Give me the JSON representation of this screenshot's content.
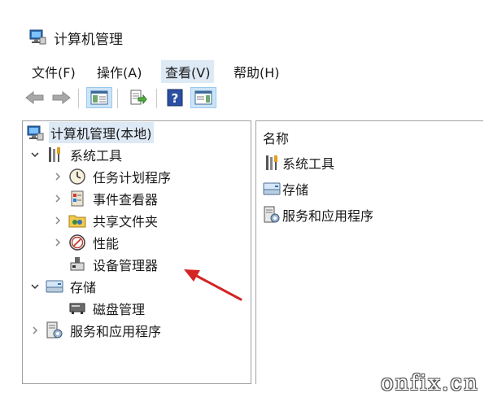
{
  "window": {
    "title": "计算机管理",
    "app_icon": "computer-management-icon"
  },
  "menu": [
    {
      "label": "文件(F)"
    },
    {
      "label": "操作(A)"
    },
    {
      "label": "查看(V)",
      "active": true
    },
    {
      "label": "帮助(H)"
    }
  ],
  "toolbar": [
    {
      "name": "back-button",
      "icon": "back-arrow-icon"
    },
    {
      "name": "forward-button",
      "icon": "forward-arrow-icon"
    },
    {
      "name": "show-hide-tree-button",
      "icon": "tree-panel-icon"
    },
    {
      "name": "export-list-button",
      "icon": "export-icon"
    },
    {
      "name": "help-button",
      "icon": "help-icon"
    },
    {
      "name": "show-action-pane-button",
      "icon": "action-pane-icon"
    }
  ],
  "tree": {
    "root": {
      "label": "计算机管理(本地)",
      "icon": "computer-management-icon",
      "selected": true
    },
    "items": [
      {
        "label": "系统工具",
        "icon": "system-tools-icon",
        "expanded": true
      },
      {
        "label": "任务计划程序",
        "icon": "clock-icon"
      },
      {
        "label": "事件查看器",
        "icon": "event-viewer-icon"
      },
      {
        "label": "共享文件夹",
        "icon": "shared-folder-icon"
      },
      {
        "label": "性能",
        "icon": "performance-icon"
      },
      {
        "label": "设备管理器",
        "icon": "device-manager-icon"
      },
      {
        "label": "存储",
        "icon": "storage-icon",
        "expanded": true
      },
      {
        "label": "磁盘管理",
        "icon": "disk-management-icon"
      },
      {
        "label": "服务和应用程序",
        "icon": "services-icon",
        "expanded": false
      }
    ]
  },
  "list": {
    "column_header": "名称",
    "items": [
      {
        "label": "系统工具",
        "icon": "system-tools-icon"
      },
      {
        "label": "存储",
        "icon": "storage-icon"
      },
      {
        "label": "服务和应用程序",
        "icon": "services-icon"
      }
    ]
  },
  "annotation": {
    "color": "#d42424",
    "target": "设备管理器"
  },
  "watermark": "onfix.cn",
  "colors": {
    "selection": "#dde9f5",
    "toolbar_pressed": "#cce4f7",
    "border": "#a0a0a0"
  }
}
